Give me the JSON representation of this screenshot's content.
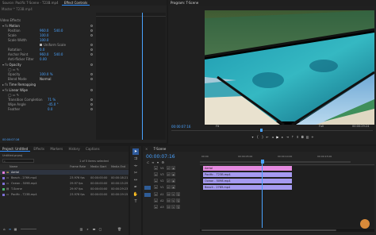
{
  "top_tabs": {
    "source_tab": "Source: Pacific T-Scene - T23B.mp4",
    "graphics_tab": "Graphics",
    "effect_controls_tab": "Effect Controls",
    "program_tab": "Program: T-Scene"
  },
  "effect_controls": {
    "master_label": "Master * T23B.mp4",
    "clip_label": "T-Scene * T23B.mp4",
    "clip_chip": "Pacific - T23B.mp4",
    "section_video": "Video Effects",
    "motion": {
      "label": "Motion",
      "position_label": "Position",
      "position_x": "960.0",
      "position_y": "540.0",
      "scale_label": "Scale",
      "scale_value": "100.0",
      "scale_width_label": "Scale Width",
      "scale_width_value": "100.0",
      "uniform_scale_label": "Uniform Scale",
      "rotation_label": "Rotation",
      "rotation_value": "0.0",
      "anchor_label": "Anchor Point",
      "anchor_x": "960.0",
      "anchor_y": "540.0",
      "flicker_label": "Anti-flicker Filter",
      "flicker_value": "0.00"
    },
    "opacity": {
      "label": "Opacity",
      "opacity_label": "Opacity",
      "opacity_value": "100.0 %",
      "blend_label": "Blend Mode",
      "blend_value": "Normal"
    },
    "time_remap": {
      "label": "Time Remapping"
    },
    "linear_wipe": {
      "label": "Linear Wipe",
      "completion_label": "Transition Completion",
      "completion_value": "71 %",
      "angle_label": "Wipe Angle",
      "angle_value": "-45.0 °",
      "feather_label": "Feather",
      "feather_value": "0.0"
    },
    "timecode": "00:00:07:16"
  },
  "program": {
    "timecode": "00:00:07:16",
    "fit": "Fit",
    "quality": "Full",
    "duration": "00:00:29:24"
  },
  "project": {
    "tabs": [
      "Project: Untitled",
      "Effects",
      "Markers",
      "History",
      "Captions"
    ],
    "path": "Untitled.prproj",
    "selection_info": "1 of 5 items selected",
    "columns": [
      "Name",
      "Frame Rate",
      "Media Start",
      "Media End"
    ],
    "items": [
      {
        "name": "Aerial",
        "fps": "",
        "start": "",
        "end": "",
        "color": "#e07ad8"
      },
      {
        "name": "Beach - 2769.mp4",
        "fps": "23.976 fps",
        "start": "00:00:00:00",
        "end": "00:00:18:21",
        "color": "#7d6fd6"
      },
      {
        "name": "Ocean - 5098.mp4",
        "fps": "29.97 fps",
        "start": "00:00:00:00",
        "end": "00:00:15:29",
        "color": "#7d6fd6"
      },
      {
        "name": "T-Scene",
        "fps": "29.97 fps",
        "start": "00:00:00:00",
        "end": "00:00:29:23",
        "color": "#4ab36b"
      },
      {
        "name": "Pacific - T23B.mp4",
        "fps": "23.976 fps",
        "start": "00:00:00:00",
        "end": "00:00:19:15",
        "color": "#7d6fd6"
      }
    ]
  },
  "timeline": {
    "tab": "T-Scene",
    "timecode": "00:00:07:16",
    "ruler_labels": [
      "00:00",
      "00:00:05:00",
      "00:00:10:00",
      "00:00:15:00"
    ],
    "tracks": [
      "V4",
      "V3",
      "V2",
      "V1",
      "A1",
      "A2",
      "A3"
    ],
    "clips": [
      {
        "track": "V4",
        "label": "Aerial",
        "color": "#e58ae0"
      },
      {
        "track": "V3",
        "label": "Pacific - T23B.mp4",
        "color": "#a59af0"
      },
      {
        "track": "V2",
        "label": "Ocean - 5098.mp4",
        "color": "#a59af0"
      },
      {
        "track": "V1",
        "label": "Beach - 2769.mp4",
        "color": "#a59af0"
      }
    ]
  },
  "colors": {
    "accent": "#2f8eff",
    "playhead": "#4aa3ff",
    "clip_pink": "#e58ae0",
    "clip_purple": "#a59af0"
  }
}
